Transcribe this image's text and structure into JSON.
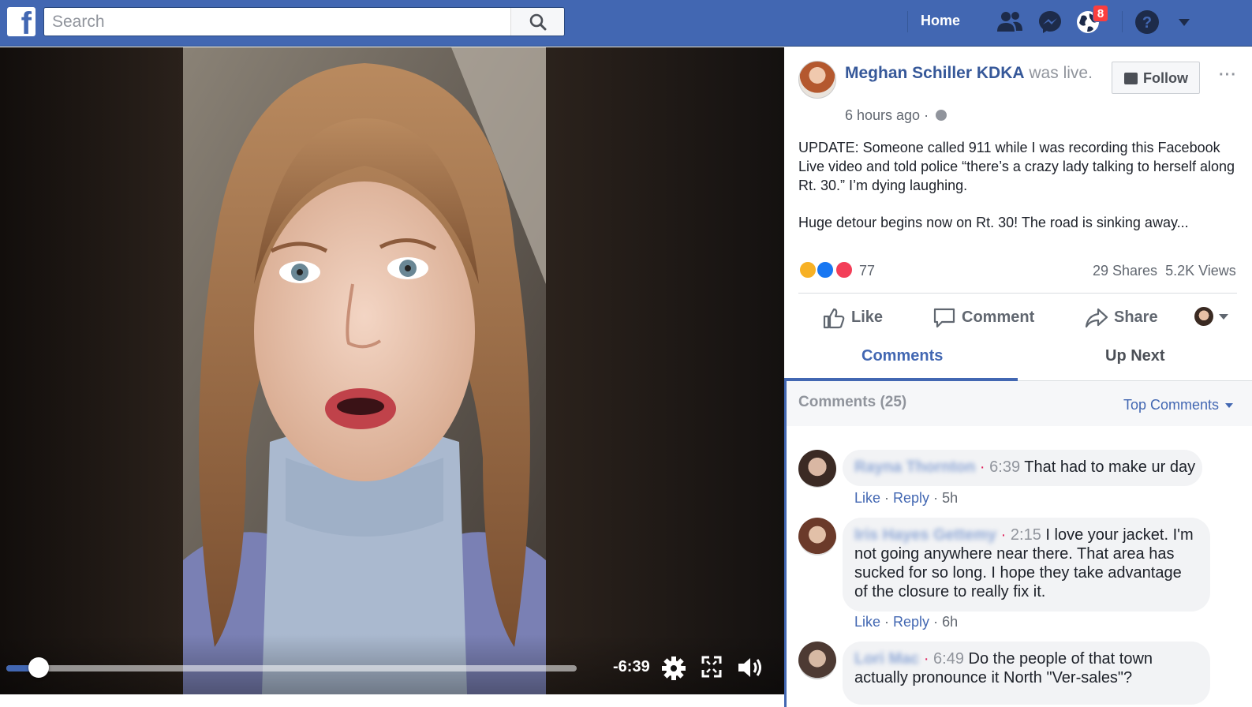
{
  "topbar": {
    "logo": "f",
    "search_placeholder": "Search",
    "home_label": "Home",
    "notifications_badge": "8"
  },
  "video": {
    "time_remaining": "-6:39",
    "progress_fraction": 0.03
  },
  "post": {
    "author": "Meghan Schiller KDKA",
    "author_suffix": "was live.",
    "timestamp": "6 hours ago",
    "follow_label": "Follow",
    "more_label": "···",
    "paragraph_1": "UPDATE: Someone called 911 while I was recording this Facebook Live video and told police “there’s a crazy lady talking to herself along Rt. 30.” I’m dying laughing.",
    "paragraph_2": "Huge detour begins now on Rt. 30! The road is sinking away...",
    "reaction_count": "77",
    "shares": "29 Shares",
    "views": "5.2K Views"
  },
  "actions": {
    "like": "Like",
    "comment": "Comment",
    "share": "Share"
  },
  "tabs": {
    "comments": "Comments",
    "up_next": "Up Next"
  },
  "comments_section": {
    "count_label": "Comments (25)",
    "sort_label": "Top Comments",
    "items": [
      {
        "name": "Rayna Thornton",
        "video_time": "6:39",
        "text": "That had to make ur day",
        "like": "Like",
        "reply": "Reply",
        "age": "5h"
      },
      {
        "name": "Iris Hayes Gettemy",
        "video_time": "2:15",
        "text": "I love your jacket. I'm not going anywhere near there. That area has sucked for so long. I hope they take advantage of the closure to really fix it.",
        "like": "Like",
        "reply": "Reply",
        "age": "6h"
      },
      {
        "name": "Lori Mac",
        "video_time": "6:49",
        "text": "Do the people of that town actually pronounce it North \"Ver-sales\"?"
      }
    ]
  },
  "colors": {
    "brand": "#4267b2",
    "badge": "#fa3e3e",
    "link": "#365899"
  }
}
